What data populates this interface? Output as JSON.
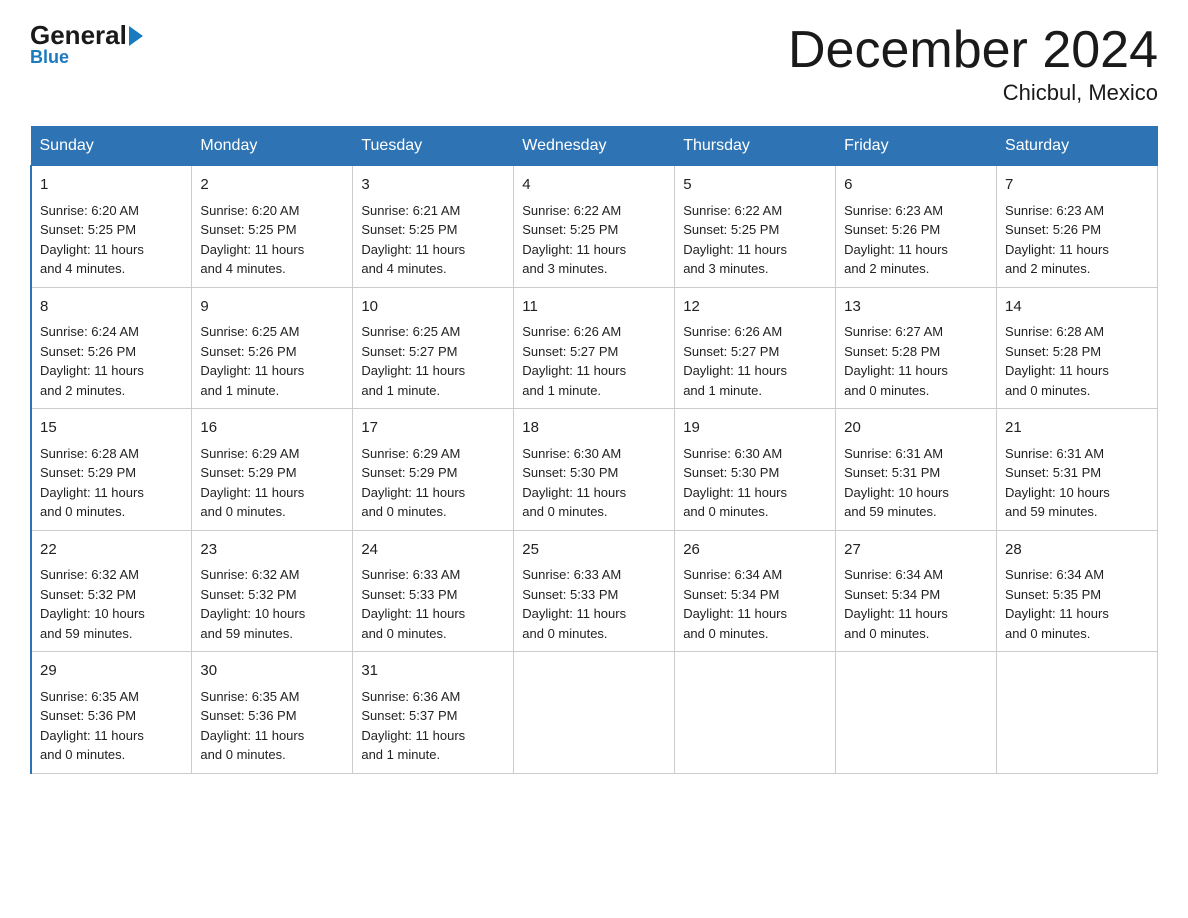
{
  "header": {
    "title": "December 2024",
    "subtitle": "Chicbul, Mexico",
    "logo_general": "General",
    "logo_blue": "Blue"
  },
  "days_of_week": [
    "Sunday",
    "Monday",
    "Tuesday",
    "Wednesday",
    "Thursday",
    "Friday",
    "Saturday"
  ],
  "weeks": [
    [
      {
        "day": "1",
        "info": "Sunrise: 6:20 AM\nSunset: 5:25 PM\nDaylight: 11 hours\nand 4 minutes."
      },
      {
        "day": "2",
        "info": "Sunrise: 6:20 AM\nSunset: 5:25 PM\nDaylight: 11 hours\nand 4 minutes."
      },
      {
        "day": "3",
        "info": "Sunrise: 6:21 AM\nSunset: 5:25 PM\nDaylight: 11 hours\nand 4 minutes."
      },
      {
        "day": "4",
        "info": "Sunrise: 6:22 AM\nSunset: 5:25 PM\nDaylight: 11 hours\nand 3 minutes."
      },
      {
        "day": "5",
        "info": "Sunrise: 6:22 AM\nSunset: 5:25 PM\nDaylight: 11 hours\nand 3 minutes."
      },
      {
        "day": "6",
        "info": "Sunrise: 6:23 AM\nSunset: 5:26 PM\nDaylight: 11 hours\nand 2 minutes."
      },
      {
        "day": "7",
        "info": "Sunrise: 6:23 AM\nSunset: 5:26 PM\nDaylight: 11 hours\nand 2 minutes."
      }
    ],
    [
      {
        "day": "8",
        "info": "Sunrise: 6:24 AM\nSunset: 5:26 PM\nDaylight: 11 hours\nand 2 minutes."
      },
      {
        "day": "9",
        "info": "Sunrise: 6:25 AM\nSunset: 5:26 PM\nDaylight: 11 hours\nand 1 minute."
      },
      {
        "day": "10",
        "info": "Sunrise: 6:25 AM\nSunset: 5:27 PM\nDaylight: 11 hours\nand 1 minute."
      },
      {
        "day": "11",
        "info": "Sunrise: 6:26 AM\nSunset: 5:27 PM\nDaylight: 11 hours\nand 1 minute."
      },
      {
        "day": "12",
        "info": "Sunrise: 6:26 AM\nSunset: 5:27 PM\nDaylight: 11 hours\nand 1 minute."
      },
      {
        "day": "13",
        "info": "Sunrise: 6:27 AM\nSunset: 5:28 PM\nDaylight: 11 hours\nand 0 minutes."
      },
      {
        "day": "14",
        "info": "Sunrise: 6:28 AM\nSunset: 5:28 PM\nDaylight: 11 hours\nand 0 minutes."
      }
    ],
    [
      {
        "day": "15",
        "info": "Sunrise: 6:28 AM\nSunset: 5:29 PM\nDaylight: 11 hours\nand 0 minutes."
      },
      {
        "day": "16",
        "info": "Sunrise: 6:29 AM\nSunset: 5:29 PM\nDaylight: 11 hours\nand 0 minutes."
      },
      {
        "day": "17",
        "info": "Sunrise: 6:29 AM\nSunset: 5:29 PM\nDaylight: 11 hours\nand 0 minutes."
      },
      {
        "day": "18",
        "info": "Sunrise: 6:30 AM\nSunset: 5:30 PM\nDaylight: 11 hours\nand 0 minutes."
      },
      {
        "day": "19",
        "info": "Sunrise: 6:30 AM\nSunset: 5:30 PM\nDaylight: 11 hours\nand 0 minutes."
      },
      {
        "day": "20",
        "info": "Sunrise: 6:31 AM\nSunset: 5:31 PM\nDaylight: 10 hours\nand 59 minutes."
      },
      {
        "day": "21",
        "info": "Sunrise: 6:31 AM\nSunset: 5:31 PM\nDaylight: 10 hours\nand 59 minutes."
      }
    ],
    [
      {
        "day": "22",
        "info": "Sunrise: 6:32 AM\nSunset: 5:32 PM\nDaylight: 10 hours\nand 59 minutes."
      },
      {
        "day": "23",
        "info": "Sunrise: 6:32 AM\nSunset: 5:32 PM\nDaylight: 10 hours\nand 59 minutes."
      },
      {
        "day": "24",
        "info": "Sunrise: 6:33 AM\nSunset: 5:33 PM\nDaylight: 11 hours\nand 0 minutes."
      },
      {
        "day": "25",
        "info": "Sunrise: 6:33 AM\nSunset: 5:33 PM\nDaylight: 11 hours\nand 0 minutes."
      },
      {
        "day": "26",
        "info": "Sunrise: 6:34 AM\nSunset: 5:34 PM\nDaylight: 11 hours\nand 0 minutes."
      },
      {
        "day": "27",
        "info": "Sunrise: 6:34 AM\nSunset: 5:34 PM\nDaylight: 11 hours\nand 0 minutes."
      },
      {
        "day": "28",
        "info": "Sunrise: 6:34 AM\nSunset: 5:35 PM\nDaylight: 11 hours\nand 0 minutes."
      }
    ],
    [
      {
        "day": "29",
        "info": "Sunrise: 6:35 AM\nSunset: 5:36 PM\nDaylight: 11 hours\nand 0 minutes."
      },
      {
        "day": "30",
        "info": "Sunrise: 6:35 AM\nSunset: 5:36 PM\nDaylight: 11 hours\nand 0 minutes."
      },
      {
        "day": "31",
        "info": "Sunrise: 6:36 AM\nSunset: 5:37 PM\nDaylight: 11 hours\nand 1 minute."
      },
      {
        "day": "",
        "info": ""
      },
      {
        "day": "",
        "info": ""
      },
      {
        "day": "",
        "info": ""
      },
      {
        "day": "",
        "info": ""
      }
    ]
  ]
}
